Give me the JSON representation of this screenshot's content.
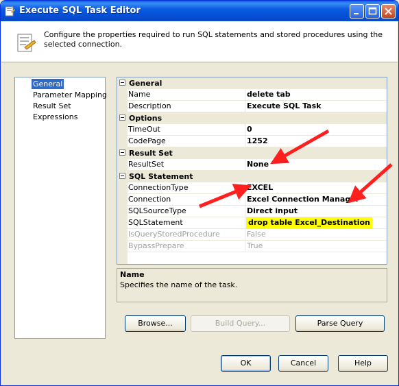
{
  "window": {
    "title": "Execute SQL Task Editor",
    "accent": "#0a5fe0"
  },
  "header": {
    "description": "Configure the properties required to run SQL statements and stored procedures using the selected connection."
  },
  "nav": {
    "items": [
      {
        "label": "General",
        "selected": true
      },
      {
        "label": "Parameter Mapping",
        "selected": false
      },
      {
        "label": "Result Set",
        "selected": false
      },
      {
        "label": "Expressions",
        "selected": false
      }
    ]
  },
  "grid": {
    "categories": [
      {
        "label": "General",
        "rows": [
          {
            "key": "Name",
            "value": "delete tab"
          },
          {
            "key": "Description",
            "value": "Execute SQL Task"
          }
        ]
      },
      {
        "label": "Options",
        "rows": [
          {
            "key": "TimeOut",
            "value": "0"
          },
          {
            "key": "CodePage",
            "value": "1252"
          }
        ]
      },
      {
        "label": "Result Set",
        "rows": [
          {
            "key": "ResultSet",
            "value": "None"
          }
        ]
      },
      {
        "label": "SQL Statement",
        "rows": [
          {
            "key": "ConnectionType",
            "value": "EXCEL"
          },
          {
            "key": "Connection",
            "value": "Excel Connection Manager"
          },
          {
            "key": "SQLSourceType",
            "value": "Direct input"
          },
          {
            "key": "SQLStatement",
            "value": "drop table Excel_Destination",
            "highlight": "#ffff00"
          },
          {
            "key": "IsQueryStoredProcedure",
            "value": "False",
            "disabled": true
          },
          {
            "key": "BypassPrepare",
            "value": "True",
            "disabled": true
          }
        ]
      }
    ]
  },
  "description_panel": {
    "title": "Name",
    "text": "Specifies the name of the task."
  },
  "buttons": {
    "browse": "Browse...",
    "build_query": "Build Query...",
    "parse_query": "Parse Query",
    "ok": "OK",
    "cancel": "Cancel",
    "help": "Help"
  },
  "annotation_color": "#ff1f1f"
}
